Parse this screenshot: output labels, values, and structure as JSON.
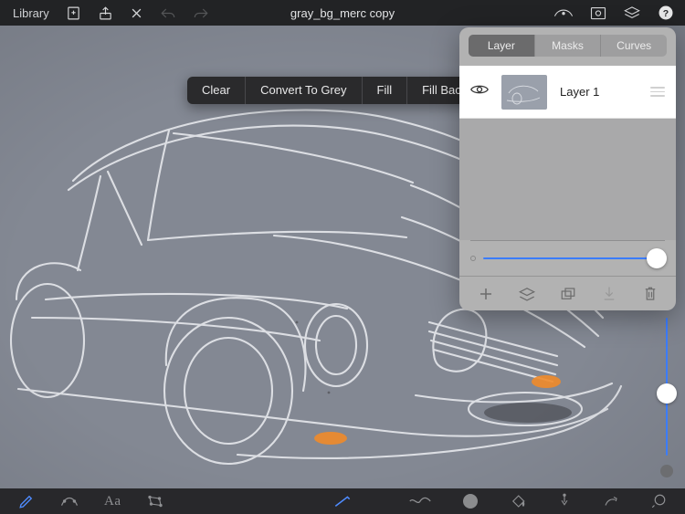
{
  "topbar": {
    "library_label": "Library",
    "title": "gray_bg_merc copy"
  },
  "fill_menu": {
    "clear": "Clear",
    "convert": "Convert To Grey",
    "fill": "Fill",
    "fill_bg": "Fill Background"
  },
  "panel": {
    "tabs": {
      "layer": "Layer",
      "masks": "Masks",
      "curves": "Curves"
    },
    "active_tab": "layer",
    "layers": [
      {
        "name": "Layer 1",
        "visible": true
      }
    ],
    "opacity": 100
  },
  "bottom": {
    "text_tool_label": "Aa"
  },
  "colors": {
    "accent": "#3b7cff",
    "canvas": "#838893",
    "panel": "#b2b2b2",
    "orange": "#ef8b2a"
  }
}
